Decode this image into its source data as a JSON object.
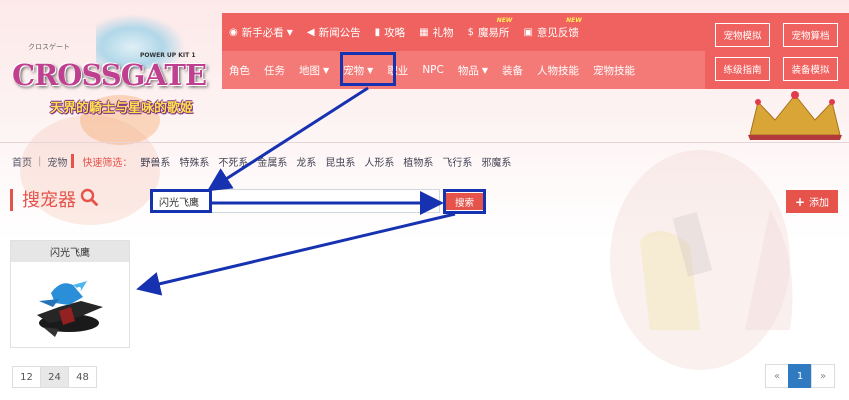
{
  "logo": {
    "kana": "クロスゲート",
    "brand": "CROSSGATE",
    "powerup": "POWER UP KIT 1",
    "tagline": "天界的騎士与星咏的歌姬"
  },
  "nav": {
    "row1": [
      {
        "icon": "eye-icon",
        "glyph": "◉",
        "label": "新手必看",
        "caret": true
      },
      {
        "icon": "bullhorn-icon",
        "glyph": "◀",
        "label": "新闻公告"
      },
      {
        "icon": "file-icon",
        "glyph": "▮",
        "label": "攻略"
      },
      {
        "icon": "gift-icon",
        "glyph": "▦",
        "label": "礼物"
      },
      {
        "icon": "dollar-icon",
        "glyph": "$",
        "label": "魔易所",
        "badge": "NEW"
      },
      {
        "icon": "feedback-icon",
        "glyph": "▣",
        "label": "意见反馈",
        "badge": "NEW"
      }
    ],
    "row2": [
      {
        "label": "角色"
      },
      {
        "label": "任务"
      },
      {
        "label": "地图",
        "caret": true
      },
      {
        "label": "宠物",
        "caret": true
      },
      {
        "label": "职业"
      },
      {
        "label": "NPC"
      },
      {
        "label": "物品",
        "caret": true
      },
      {
        "label": "装备"
      },
      {
        "label": "人物技能"
      },
      {
        "label": "宠物技能"
      }
    ],
    "side": [
      "宠物模拟",
      "宠物算档",
      "练级指南",
      "装备模拟"
    ]
  },
  "breadcrumb": {
    "home": "首页",
    "current": "宠物",
    "filter_label": "快速筛选：",
    "filters": [
      "野兽系",
      "特殊系",
      "不死系",
      "金属系",
      "龙系",
      "昆虫系",
      "人形系",
      "植物系",
      "飞行系",
      "邪魔系"
    ]
  },
  "search": {
    "title": "搜宠器",
    "value": "闪光飞鹰",
    "button": "搜索",
    "add": "添加"
  },
  "result": {
    "name": "闪光飞鹰"
  },
  "per_page": {
    "options": [
      "12",
      "24",
      "48"
    ],
    "active": "24"
  },
  "pagination": {
    "prev": "«",
    "current": "1",
    "next": "»"
  },
  "colors": {
    "accent": "#e5534b",
    "nav": "#f0625f",
    "annotation": "#1732b0",
    "pager_active": "#2f7ac0"
  }
}
